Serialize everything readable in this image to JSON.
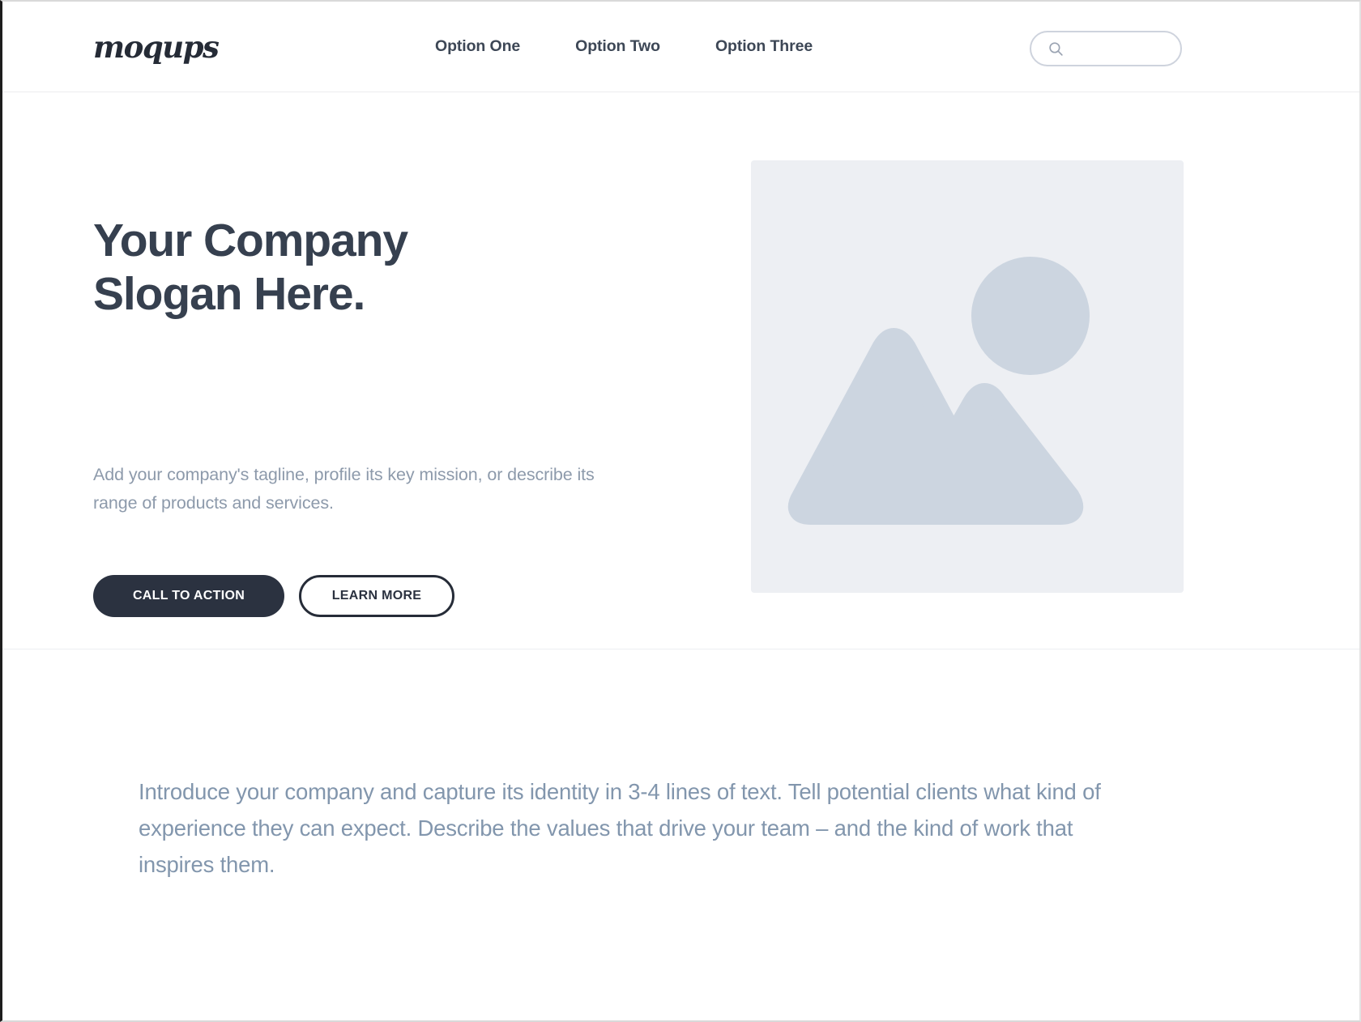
{
  "header": {
    "logo_text": "moqups",
    "nav": [
      {
        "label": "Option One"
      },
      {
        "label": "Option Two"
      },
      {
        "label": "Option Three"
      }
    ],
    "search": {
      "icon": "search-icon",
      "value": "",
      "placeholder": ""
    }
  },
  "hero": {
    "title_line1": "Your Company",
    "title_line2": "Slogan Here.",
    "subtitle": "Add your company's tagline, profile its key mission, or describe its range of products and services.",
    "primary_button": "CALL TO ACTION",
    "secondary_button": "LEARN MORE",
    "image_placeholder": {
      "icon": "image-placeholder-mountains-sun-icon"
    }
  },
  "intro": {
    "paragraph": "Introduce your company and capture its identity in 3-4 lines of text. Tell potential clients what kind of experience they can expect. Describe the values that drive your team – and the kind of work that inspires them."
  },
  "colors": {
    "heading": "#36404f",
    "nav_text": "#3d4756",
    "muted_text": "#8d9aab",
    "intro_text": "#8296ad",
    "button_dark": "#2b3240",
    "placeholder_bg": "#edeff3",
    "placeholder_shape": "#ccd5e0",
    "border": "#ececef"
  }
}
